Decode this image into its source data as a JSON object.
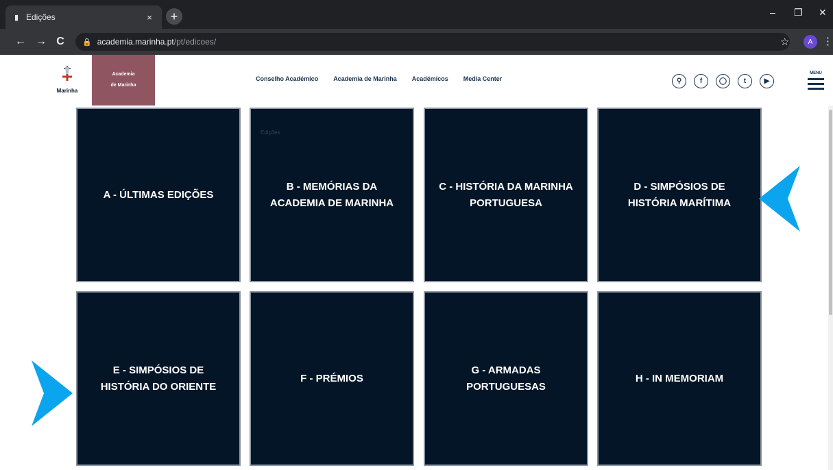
{
  "browser": {
    "tab_title": "Edições",
    "tab_close": "×",
    "new_tab": "+",
    "url_host": "academia.marinha.pt",
    "url_path": "/pt/edicoes/",
    "minimize": "–",
    "maximize": "❐",
    "close": "✕",
    "profile_initial": "A",
    "back": "←",
    "forward": "→",
    "reload": "C",
    "star": "☆",
    "menu": "⋮",
    "lock": "🔒"
  },
  "header": {
    "logo_name": "Marinha",
    "brand_line1": "Academia",
    "brand_line2": "de Marinha",
    "nav": [
      "Conselho Académico",
      "Academia de Marinha",
      "Académicos",
      "Media Center"
    ],
    "menu_label": "MENU",
    "social_icons": [
      "search-icon",
      "facebook-icon",
      "instagram-icon",
      "twitter-icon",
      "youtube-icon"
    ]
  },
  "page": {
    "faint_label": "Edições",
    "cards": [
      "A - ÚLTIMAS EDIÇÕES",
      "B - MEMÓRIAS DA ACADEMIA DE MARINHA",
      "C - HISTÓRIA DA MARINHA PORTUGUESA",
      "D - SIMPÓSIOS DE HISTÓRIA MARÍTIMA",
      "E - SIMPÓSIOS DE HISTÓRIA DO ORIENTE",
      "F - PRÉMIOS",
      "G - ARMADAS PORTUGUESAS",
      "H - IN MEMORIAM"
    ]
  },
  "colors": {
    "card_bg": "#041527",
    "brand": "#8f5560",
    "arrow": "#0aa5ee"
  }
}
